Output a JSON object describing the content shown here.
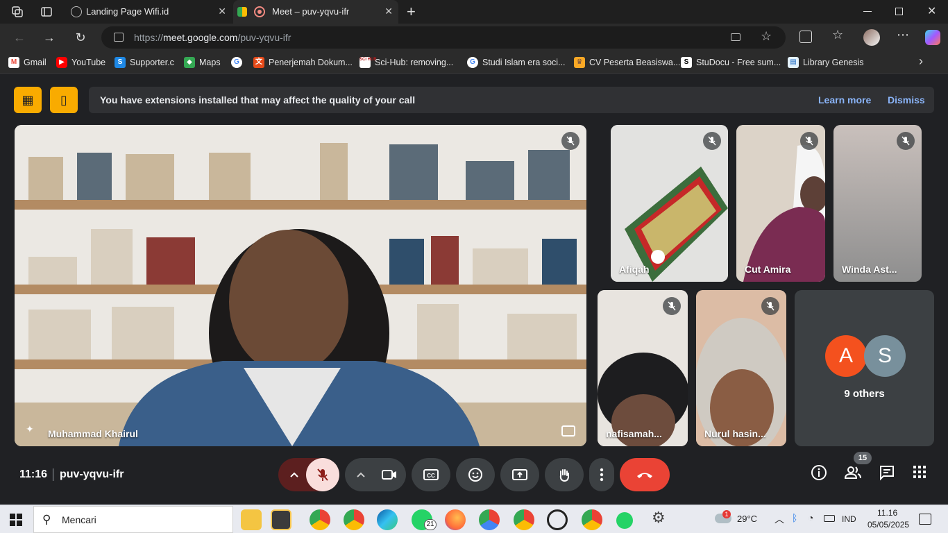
{
  "browser": {
    "tabs": [
      {
        "label": "Landing Page Wifi.id",
        "active": false
      },
      {
        "label": "Meet – puv-yqvu-ifr",
        "active": true
      }
    ],
    "url_prefix": "https://",
    "url_host": "meet.google.com",
    "url_path": "/puv-yqvu-ifr",
    "bookmarks": [
      "Gmail",
      "YouTube",
      "Supporter.c",
      "Maps",
      "Penerjemah Dokum...",
      "Sci-Hub: removing...",
      "Studi Islam era soci...",
      "CV Peserta Beasiswa...",
      "StuDocu - Free sum...",
      "Library Genesis"
    ],
    "sci_hub_icon_text": "SCI HUB"
  },
  "meet": {
    "banner_text": "You have extensions installed that may affect the quality of your call",
    "learn_more": "Learn more",
    "dismiss": "Dismiss",
    "main_speaker": "Muhammad Khairul",
    "participants": [
      "Afiqah",
      "Cut Amira",
      "Winda Ast...",
      "nafisamah...",
      "Nurul hasin..."
    ],
    "others": {
      "avatar_a": "A",
      "avatar_s": "S",
      "label": "9 others"
    },
    "time": "11:16",
    "meeting_code": "puv-yqvu-ifr",
    "people_count": "15",
    "colors": {
      "accent": "#8ab4f8",
      "mic_off_bg": "#f9dedc",
      "end_call": "#ea4335",
      "warning": "#f9ab00"
    }
  },
  "taskbar": {
    "search_placeholder": "Mencari",
    "whatsapp_badge": "21",
    "weather_badge": "1",
    "temperature": "29°C",
    "lang": "IND",
    "clock_time": "11.16",
    "clock_date": "05/05/2025"
  }
}
